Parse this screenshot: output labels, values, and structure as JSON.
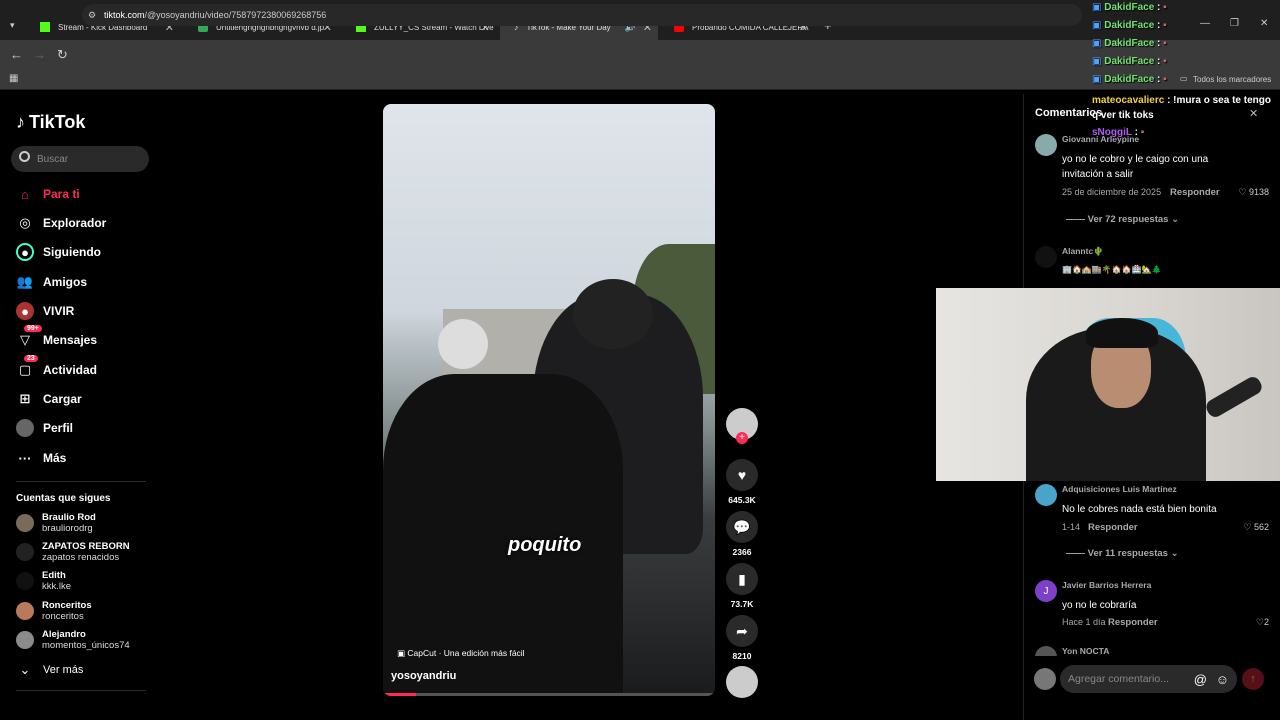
{
  "browser": {
    "tabs": [
      {
        "label": "Stream - Kick Dashboard",
        "fav_color": "#53fc18"
      },
      {
        "label": "Untitlehgngngnbngngvhvb d.jp",
        "fav_color": "#34a853"
      },
      {
        "label": "ZULLYY_CS Stream - Watch Live",
        "fav_color": "#53fc18"
      },
      {
        "label": "TikTok - Make Your Day",
        "fav_color": "#ffffff"
      },
      {
        "label": "Probando COMIDA CALLEJERA",
        "fav_color": "#ff0000"
      }
    ],
    "url_host": "tiktok.com",
    "url_path": "/@yosoyandriu/video/7587972380069268756",
    "bookmarks_label": "Todos los marcadores"
  },
  "sidebar": {
    "logo": "TikTok",
    "search_placeholder": "Buscar",
    "nav": [
      {
        "label": "Para ti",
        "icon": "home-icon",
        "active": true
      },
      {
        "label": "Explorador",
        "icon": "compass-icon"
      },
      {
        "label": "Siguiendo",
        "icon": "following-icon"
      },
      {
        "label": "Amigos",
        "icon": "friends-icon"
      },
      {
        "label": "VIVIR",
        "icon": "live-icon"
      },
      {
        "label": "Mensajes",
        "icon": "messages-icon",
        "badge": "99+"
      },
      {
        "label": "Actividad",
        "icon": "activity-icon",
        "badge": "23"
      },
      {
        "label": "Cargar",
        "icon": "upload-icon"
      },
      {
        "label": "Perfil",
        "icon": "profile-icon"
      },
      {
        "label": "Más",
        "icon": "more-icon"
      }
    ],
    "following_title": "Cuentas que sigues",
    "following": [
      {
        "name": "Braulio Rod",
        "user": "brauliorodrg"
      },
      {
        "name": "ZAPATOS REBORN",
        "user": "zapatos renacidos"
      },
      {
        "name": "Edith",
        "user": "kkk.lke"
      },
      {
        "name": "Ronceritos",
        "user": "ronceritos"
      },
      {
        "name": "Alejandro",
        "user": "momentos_únicos74"
      }
    ],
    "see_more": "Ver más"
  },
  "video": {
    "caption_overlay": "poquito",
    "capcut": "CapCut · Una edición más fácil",
    "username": "yosoyandriu",
    "progress": 0.1
  },
  "actions": {
    "likes": "645.3K",
    "comments": "2366",
    "saves": "73.7K",
    "shares": "8210"
  },
  "comments": {
    "title": "Comentarios",
    "items": [
      {
        "user": "Giovanni Arleypine",
        "text": "yo no le cobro y le caigo con una invitación a salir",
        "date": "25 de diciembre de 2025",
        "reply": "Responder",
        "likes": "9138",
        "more": "Ver 72 respuestas"
      },
      {
        "user": "Alanntc🌵",
        "text": "🏢🏠🏫🏬🌴🏠🏠🏥🏡🌲"
      },
      {
        "user": "Adquisiciones Luis Martínez",
        "text": "No le cobres nada está bien bonita",
        "date": "1-14",
        "reply": "Responder",
        "likes": "562",
        "more": "Ver 11 respuestas"
      },
      {
        "user": "Javier Barrios Herrera",
        "avatar_letter": "J",
        "text": "yo no le cobraría",
        "date": "Hace 1 día",
        "reply": "Responder",
        "likes": "2"
      },
      {
        "user": "Yon NOCTA"
      }
    ],
    "add_placeholder": "Agregar comentario..."
  },
  "stream_chat": [
    {
      "user": "DakidFace",
      "msg": ":"
    },
    {
      "user": "DakidFace",
      "msg": ":"
    },
    {
      "user": "DakidFace",
      "msg": ":"
    },
    {
      "user": "DakidFace",
      "msg": ":"
    },
    {
      "user": "DakidFace",
      "msg": ":"
    },
    {
      "user": "mateocavalierc",
      "msg": ": !mura o sea te tengo q ver tik toks"
    },
    {
      "user": "sNoggiL",
      "msg": ":"
    }
  ]
}
